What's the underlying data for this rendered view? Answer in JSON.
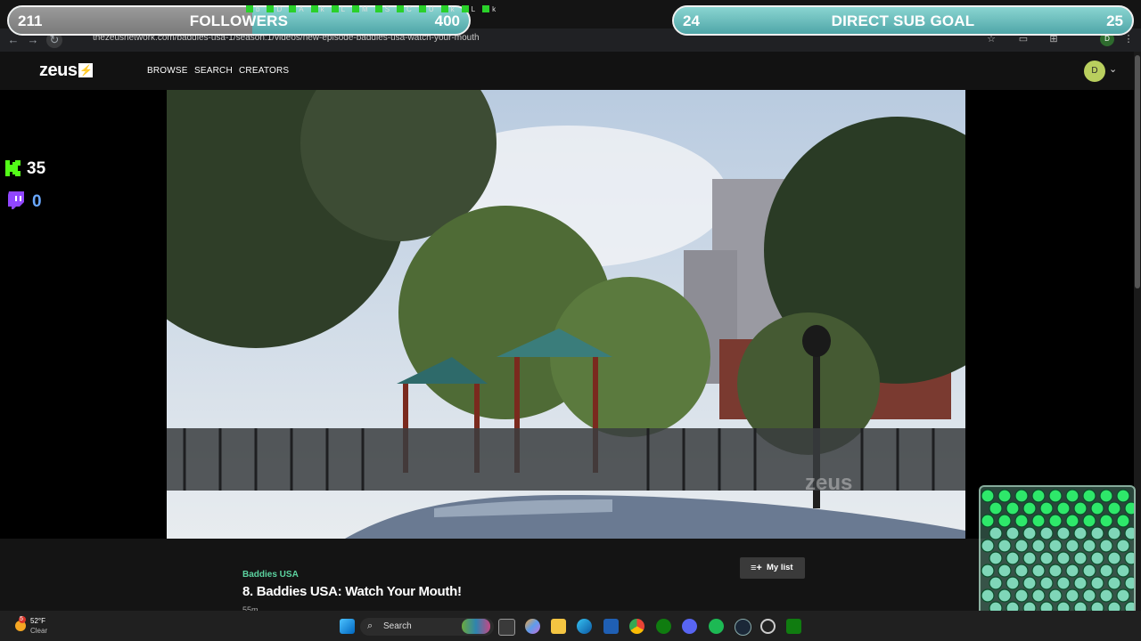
{
  "browser": {
    "url": "thezeusnetwork.com/baddies-usa-1/season:1/videos/new-episode-baddies-usa-watch-your-mouth"
  },
  "site": {
    "logo": "zeus",
    "nav": [
      "BROWSE",
      "SEARCH",
      "CREATORS"
    ],
    "avatar_initial": "D"
  },
  "episode": {
    "show": "Baddies USA",
    "title": "8. Baddies USA: Watch Your Mouth!",
    "duration": "55m",
    "mylist_label": "My list",
    "watermark": "zeus"
  },
  "overlay": {
    "followers": {
      "current": "211",
      "label": "FOLLOWERS",
      "goal": "400",
      "progress": 0.53
    },
    "sub_goal": {
      "current": "24",
      "label": "DIRECT SUB GOAL",
      "goal": "25",
      "progress": 0.96
    },
    "ticker": [
      "b",
      "D",
      "A",
      "k",
      "L",
      "M",
      "S",
      "C",
      "U",
      "k",
      "L",
      "k"
    ],
    "kick_count": "35",
    "twitch_count": "0"
  },
  "taskbar": {
    "weather_temp": "52°F",
    "weather_cond": "Clear",
    "weather_badge": "5",
    "search_label": "Search"
  },
  "colors": {
    "accent_green": "#5cd3a0",
    "kick_green": "#53fc18",
    "twitch_purple": "#9146ff",
    "goal_teal": "#6cc4c4"
  }
}
